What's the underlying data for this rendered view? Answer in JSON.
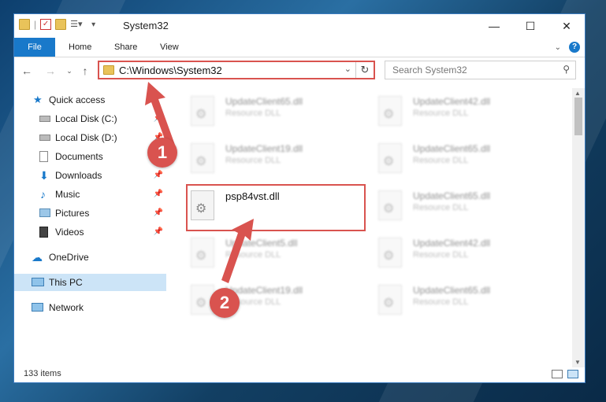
{
  "window": {
    "title": "System32",
    "controls": {
      "minimize": "—",
      "maximize": "☐",
      "close": "✕"
    }
  },
  "ribbon": {
    "tabs": [
      "File",
      "Home",
      "Share",
      "View"
    ]
  },
  "address": {
    "path": "C:\\Windows\\System32"
  },
  "search": {
    "placeholder": "Search System32"
  },
  "sidebar": {
    "items": [
      {
        "label": "Quick access",
        "icon": "star-icon"
      },
      {
        "label": "Local Disk (C:)",
        "icon": "drive-icon"
      },
      {
        "label": "Local Disk (D:)",
        "icon": "drive-icon"
      },
      {
        "label": "Documents",
        "icon": "documents-icon"
      },
      {
        "label": "Downloads",
        "icon": "download-icon"
      },
      {
        "label": "Music",
        "icon": "music-icon"
      },
      {
        "label": "Pictures",
        "icon": "pictures-icon"
      },
      {
        "label": "Videos",
        "icon": "videos-icon"
      },
      {
        "label": "OneDrive",
        "icon": "cloud-icon"
      },
      {
        "label": "This PC",
        "icon": "computer-icon"
      },
      {
        "label": "Network",
        "icon": "network-icon"
      }
    ]
  },
  "files": {
    "left": [
      {
        "name": "UpdateClient65.dll",
        "type": "Resource DLL"
      },
      {
        "name": "UpdateClient19.dll",
        "type": "Resource DLL"
      },
      {
        "name": "psp84vst.dll",
        "type": ""
      },
      {
        "name": "UpdateClient5.dll",
        "type": "Resource DLL"
      },
      {
        "name": "UpdateClient19.dll",
        "type": "Resource DLL"
      }
    ],
    "right": [
      {
        "name": "UpdateClient42.dll",
        "type": "Resource DLL"
      },
      {
        "name": "UpdateClient65.dll",
        "type": "Resource DLL"
      },
      {
        "name": "UpdateClient65.dll",
        "type": "Resource DLL"
      },
      {
        "name": "UpdateClient42.dll",
        "type": "Resource DLL"
      },
      {
        "name": "UpdateClient65.dll",
        "type": "Resource DLL"
      }
    ]
  },
  "status": {
    "item_count": "133 items"
  },
  "callouts": [
    "1",
    "2"
  ],
  "colors": {
    "accent": "#1979ca",
    "highlight": "#d9534f",
    "selected": "#cce4f7"
  }
}
